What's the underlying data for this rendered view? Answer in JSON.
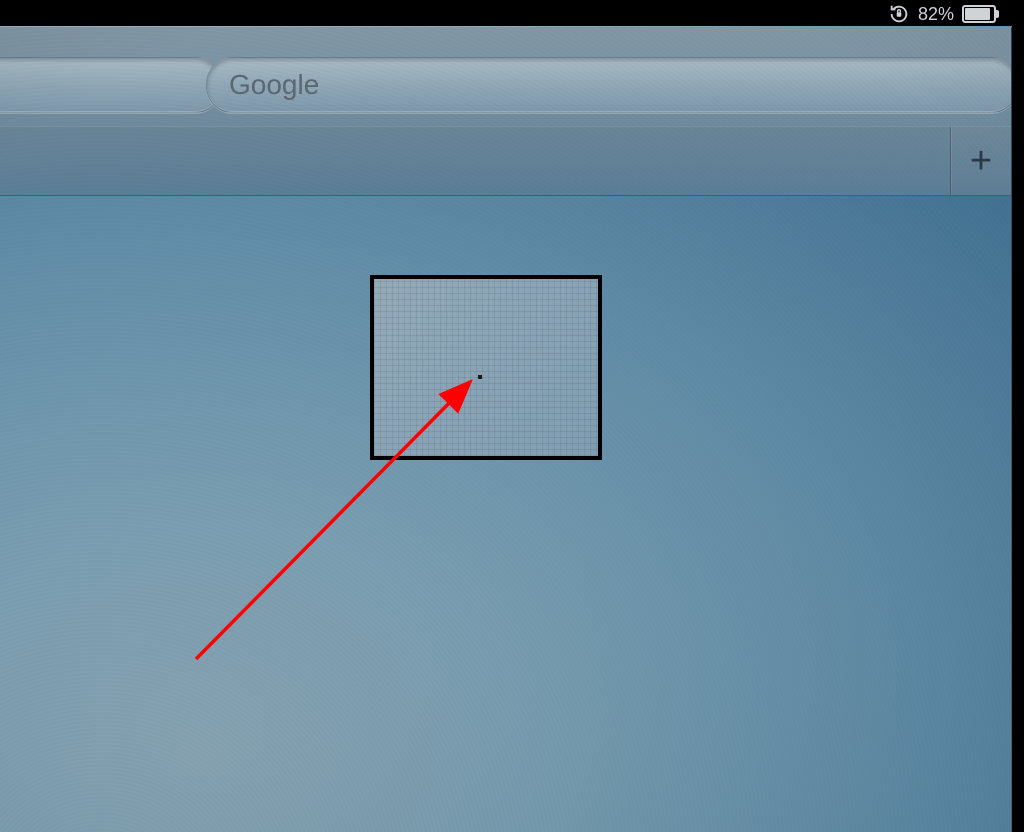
{
  "status": {
    "battery_percent_text": "82%",
    "battery_fill_percent": "82",
    "lock_icon": "orientation-lock-icon"
  },
  "toolbar": {
    "url_value": "",
    "search_placeholder": "Google",
    "search_value": ""
  },
  "tabs": {
    "add_label": "+"
  },
  "annotation": {
    "label": "dead-pixel-highlight"
  }
}
